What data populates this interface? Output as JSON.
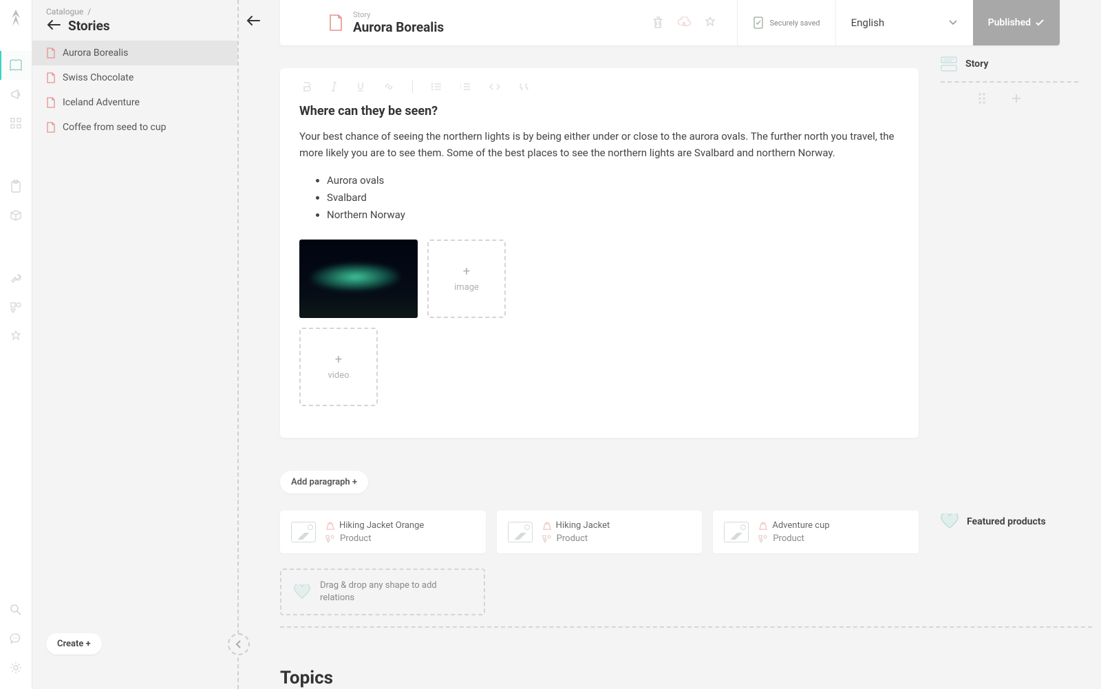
{
  "sidebar": {
    "breadcrumb": "Catalogue",
    "title": "Stories",
    "items": [
      {
        "label": "Aurora Borealis",
        "active": true
      },
      {
        "label": "Swiss Chocolate",
        "active": false
      },
      {
        "label": "Iceland Adventure",
        "active": false
      },
      {
        "label": "Coffee from seed to cup",
        "active": false
      }
    ],
    "create_label": "Create +"
  },
  "header": {
    "type_label": "Story",
    "title": "Aurora Borealis",
    "saved_label": "Securely saved",
    "language": "English",
    "publish_label": "Published"
  },
  "content": {
    "heading": "Where can they be seen?",
    "paragraph": "Your best chance of seeing the northern lights is by being either under or close to the aurora ovals. The further north you travel, the more likely you are to see them. Some of the best places to see the northern lights are Svalbard and northern Norway.",
    "list": [
      "Aurora ovals",
      "Svalbard",
      "Northern Norway"
    ],
    "add_image_label": "image",
    "add_video_label": "video"
  },
  "add_paragraph_label": "Add paragraph +",
  "featured": {
    "title": "Featured products",
    "type_label": "Product",
    "items": [
      {
        "name": "Hiking Jacket Orange"
      },
      {
        "name": "Hiking Jacket"
      },
      {
        "name": "Adventure cup"
      }
    ],
    "drag_label": "Drag & drop any shape to add relations"
  },
  "right": {
    "story_label": "Story"
  },
  "topics_heading": "Topics"
}
